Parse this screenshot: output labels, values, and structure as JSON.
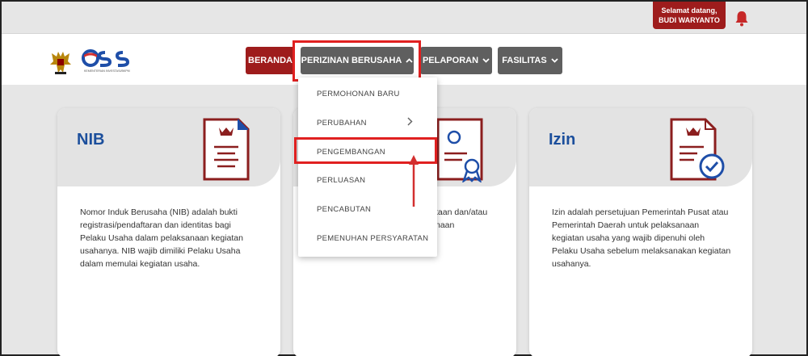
{
  "header": {
    "welcome_line1": "Selamat datang,",
    "welcome_line2": "BUDI WARYANTO",
    "bell_icon": "bell-icon"
  },
  "logo": {
    "text": "OSS",
    "subtitle": "KEMENTERIAN INVESTASI/BKPM"
  },
  "nav": {
    "items": [
      {
        "label": "BERANDA",
        "chevron": ""
      },
      {
        "label": "PERIZINAN BERUSAHA",
        "chevron": "up"
      },
      {
        "label": "PELAPORAN",
        "chevron": "down"
      },
      {
        "label": "FASILITAS",
        "chevron": "down"
      }
    ],
    "colors": {
      "beranda": "#9e1c1c",
      "default": "#5f5f5f",
      "highlight": "#e02020"
    }
  },
  "dropdown": {
    "items": [
      {
        "label": "PERMOHONAN BARU"
      },
      {
        "label": "PERUBAHAN",
        "submenu": true
      },
      {
        "label": "PENGEMBANGAN",
        "highlighted": true
      },
      {
        "label": "PERLUASAN"
      },
      {
        "label": "PENCABUTAN"
      },
      {
        "label": "PEMENUHAN PERSYARATAN"
      }
    ]
  },
  "cards": [
    {
      "title": "NIB",
      "icon": "document-icon",
      "lines": [
        "Nomor Induk Berusaha (NIB) adalah bukti",
        "registrasi/pendaftaran dan identitas bagi",
        "Pelaku Usaha dalam pelaksanaan kegiatan",
        "usahanya. NIB wajib dimiliki Pelaku Usaha",
        "dalam memulai kegiatan usaha."
      ]
    },
    {
      "title": "",
      "icon": "certificate-icon",
      "lines": [
        "taan dan/atau",
        "naan"
      ]
    },
    {
      "title": "Izin",
      "icon": "approved-document-icon",
      "lines": [
        "Izin adalah persetujuan Pemerintah Pusat atau",
        "Pemerintah Daerah untuk pelaksanaan",
        "kegiatan usaha yang wajib dipenuhi oleh",
        "Pelaku Usaha sebelum melaksanakan kegiatan",
        "usahanya."
      ]
    }
  ]
}
